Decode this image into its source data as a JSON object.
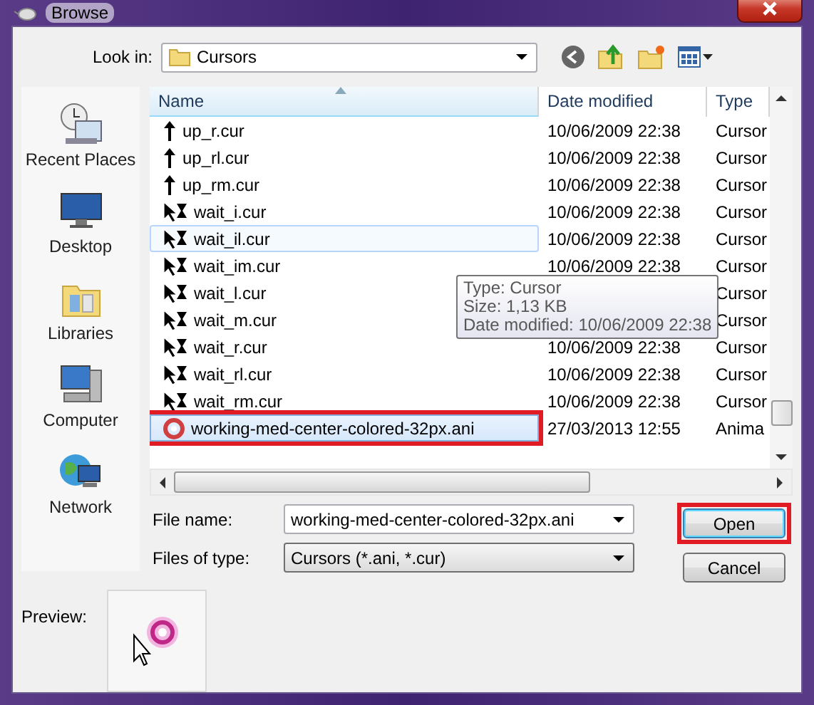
{
  "window": {
    "title": "Browse"
  },
  "look_in": {
    "label": "Look in:",
    "value": "Cursors"
  },
  "places": [
    {
      "label": "Recent Places"
    },
    {
      "label": "Desktop"
    },
    {
      "label": "Libraries"
    },
    {
      "label": "Computer"
    },
    {
      "label": "Network"
    }
  ],
  "table": {
    "columns": [
      "Name",
      "Date modified",
      "Type"
    ],
    "rows": [
      {
        "kind": "arrow",
        "name": "up_r.cur",
        "date": "10/06/2009 22:38",
        "type": "Cursor",
        "selected": false,
        "hovered": false,
        "annotated": false
      },
      {
        "kind": "arrow",
        "name": "up_rl.cur",
        "date": "10/06/2009 22:38",
        "type": "Cursor",
        "selected": false,
        "hovered": false,
        "annotated": false
      },
      {
        "kind": "arrow",
        "name": "up_rm.cur",
        "date": "10/06/2009 22:38",
        "type": "Cursor",
        "selected": false,
        "hovered": false,
        "annotated": false
      },
      {
        "kind": "wait",
        "name": "wait_i.cur",
        "date": "10/06/2009 22:38",
        "type": "Cursor",
        "selected": false,
        "hovered": false,
        "annotated": false
      },
      {
        "kind": "wait",
        "name": "wait_il.cur",
        "date": "10/06/2009 22:38",
        "type": "Cursor",
        "selected": false,
        "hovered": true,
        "annotated": false
      },
      {
        "kind": "wait",
        "name": "wait_im.cur",
        "date": "10/06/2009 22:38",
        "type": "Cursor",
        "selected": false,
        "hovered": false,
        "annotated": false
      },
      {
        "kind": "wait",
        "name": "wait_l.cur",
        "type": "Cursor",
        "selected": false,
        "hovered": false,
        "annotated": false
      },
      {
        "kind": "wait",
        "name": "wait_m.cur",
        "type": "Cursor",
        "selected": false,
        "hovered": false,
        "annotated": false
      },
      {
        "kind": "wait",
        "name": "wait_r.cur",
        "date": "10/06/2009 22:38",
        "type": "Cursor",
        "selected": false,
        "hovered": false,
        "annotated": false
      },
      {
        "kind": "wait",
        "name": "wait_rl.cur",
        "date": "10/06/2009 22:38",
        "type": "Cursor",
        "selected": false,
        "hovered": false,
        "annotated": false
      },
      {
        "kind": "wait",
        "name": "wait_rm.cur",
        "date": "10/06/2009 22:38",
        "type": "Cursor",
        "selected": false,
        "hovered": false,
        "annotated": false
      },
      {
        "kind": "ani",
        "name": "working-med-center-colored-32px.ani",
        "date": "27/03/2013 12:55",
        "type": "Anima",
        "selected": true,
        "hovered": false,
        "annotated": true
      }
    ]
  },
  "tooltip": {
    "lines": [
      "Type: Cursor",
      "Size: 1,13 KB",
      "Date modified: 10/06/2009 22:38"
    ]
  },
  "file_name": {
    "label": "File name:",
    "value": "working-med-center-colored-32px.ani"
  },
  "file_type": {
    "label": "Files of type:",
    "value": "Cursors (*.ani, *.cur)"
  },
  "buttons": [
    {
      "label": "Open",
      "annotated": true
    },
    {
      "label": "Cancel",
      "annotated": false
    }
  ],
  "preview": {
    "label": "Preview:"
  }
}
